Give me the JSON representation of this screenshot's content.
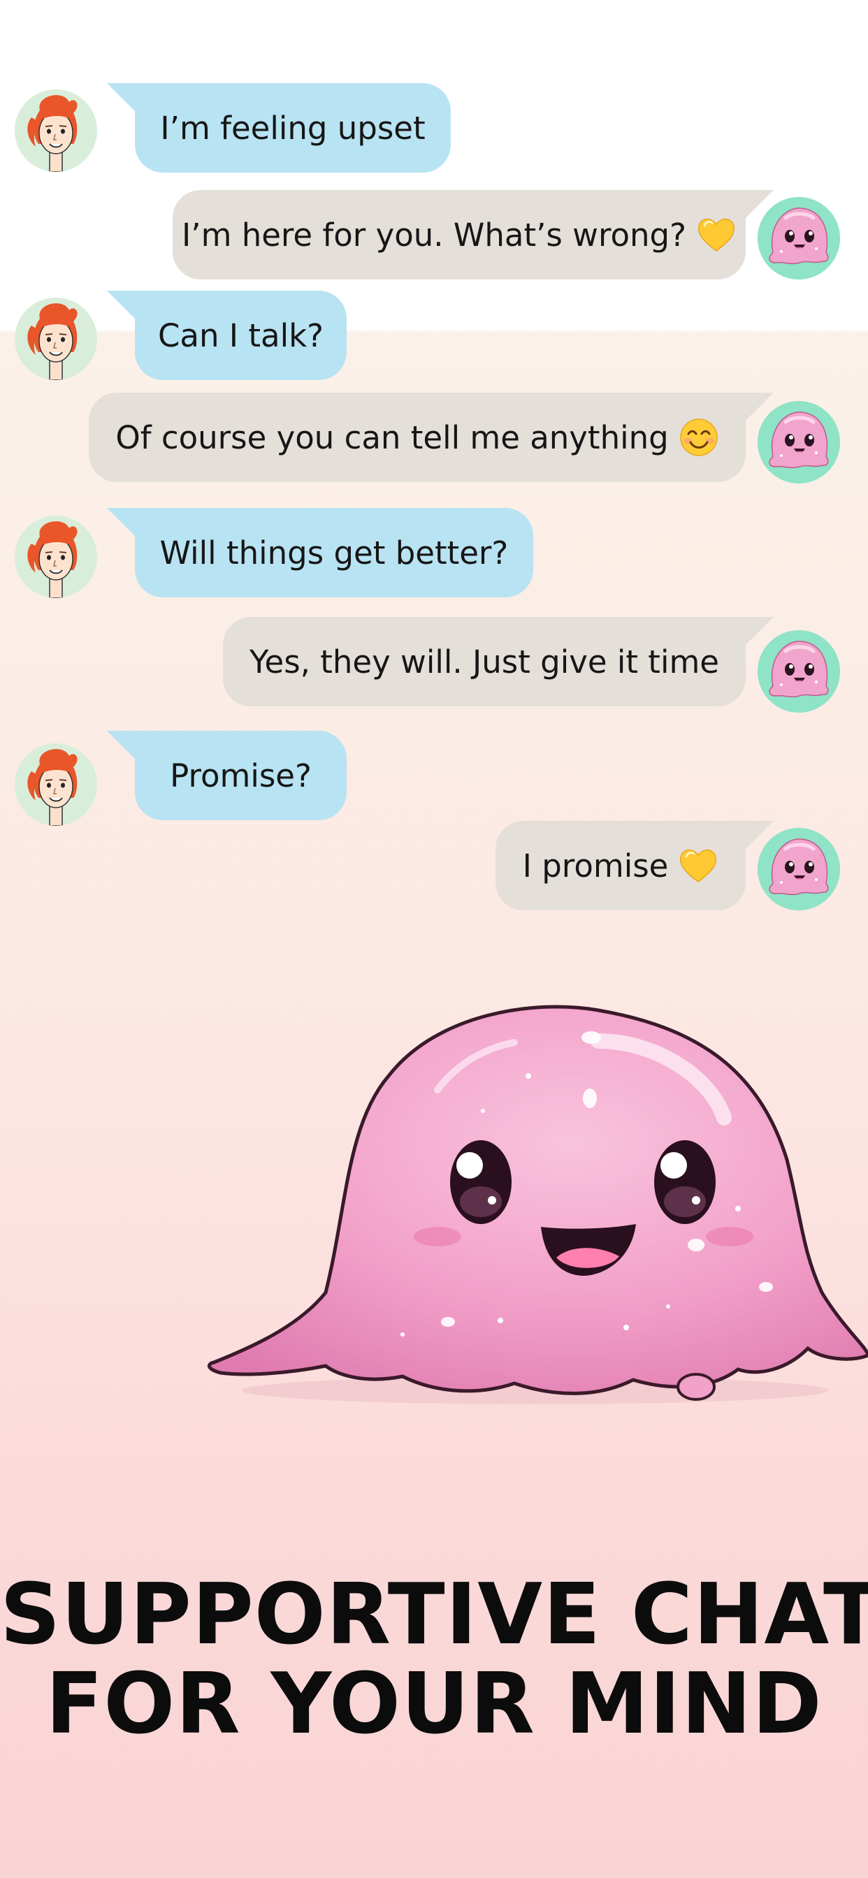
{
  "messages": [
    {
      "sender": "user",
      "text": "I’m feeling upset",
      "emoji": ""
    },
    {
      "sender": "bot",
      "text": "I’m here for you. What’s wrong?",
      "emoji": "yellow-heart"
    },
    {
      "sender": "user",
      "text": "Can I talk?",
      "emoji": ""
    },
    {
      "sender": "bot",
      "text": "Of course you can tell me anything",
      "emoji": "smiling-face"
    },
    {
      "sender": "user",
      "text": "Will things get better?",
      "emoji": ""
    },
    {
      "sender": "bot",
      "text": "Yes, they will. Just give it time",
      "emoji": ""
    },
    {
      "sender": "user",
      "text": "Promise?",
      "emoji": ""
    },
    {
      "sender": "bot",
      "text": "I promise",
      "emoji": "yellow-heart"
    }
  ],
  "headline": {
    "line1": "SUPPORTIVE CHAT",
    "line2": "FOR YOUR MIND"
  },
  "colors": {
    "user_bubble": "#b8e3f2",
    "bot_bubble": "#e5dfda",
    "bot_avatar_ring": "#8fe3c7",
    "user_avatar_bg": "#d8eedb",
    "mascot_pink": "#f3a6cc",
    "hair": "#e8562a"
  }
}
